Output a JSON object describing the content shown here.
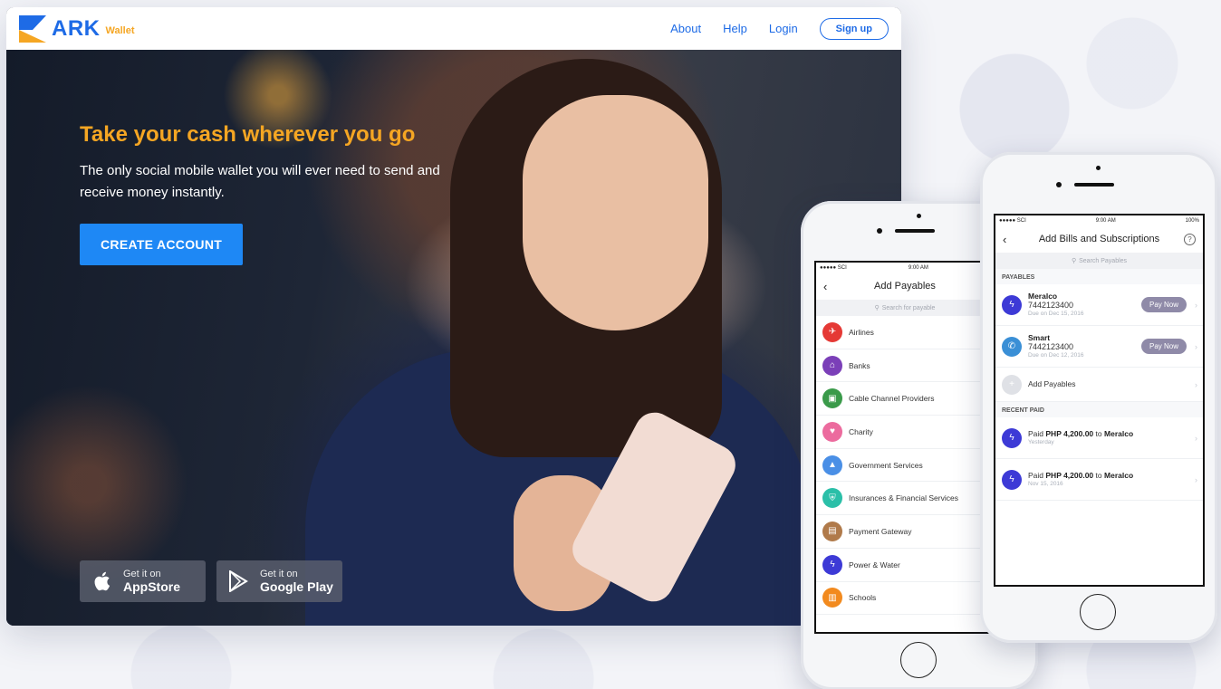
{
  "nav": {
    "brand": "ARK",
    "brand_sub": "Wallet",
    "links": [
      "About",
      "Help",
      "Login"
    ],
    "signup": "Sign up"
  },
  "hero": {
    "title": "Take your cash wherever you go",
    "subtitle": "The only social mobile wallet you will ever need to send and receive money instantly.",
    "cta": "CREATE ACCOUNT",
    "stores": [
      {
        "small": "Get it on",
        "big": "AppStore",
        "icon": "apple-icon"
      },
      {
        "small": "Get it on",
        "big": "Google Play",
        "icon": "play-icon"
      }
    ]
  },
  "phone_left": {
    "status": {
      "carrier": "●●●●● SCI ",
      "time": "9:00 AM"
    },
    "title": "Add Payables",
    "search_placeholder": "Search for payable",
    "categories": [
      {
        "label": "Airlines",
        "color": "#e53935",
        "icon": "plane-icon"
      },
      {
        "label": "Banks",
        "color": "#7b3fb8",
        "icon": "bank-icon"
      },
      {
        "label": "Cable Channel Providers",
        "color": "#3a9a4a",
        "icon": "tv-icon"
      },
      {
        "label": "Charity",
        "color": "#ec6b9e",
        "icon": "heart-icon"
      },
      {
        "label": "Government Services",
        "color": "#4a8fe6",
        "icon": "government-icon"
      },
      {
        "label": "Insurances & Financial Services",
        "color": "#2bbfa8",
        "icon": "shield-icon"
      },
      {
        "label": "Payment Gateway",
        "color": "#b07a4a",
        "icon": "wallet-icon"
      },
      {
        "label": "Power & Water",
        "color": "#3d3ad6",
        "icon": "power-icon"
      },
      {
        "label": "Schools",
        "color": "#f28a1e",
        "icon": "book-icon"
      }
    ]
  },
  "phone_right": {
    "status": {
      "carrier": "●●●●● SCI ",
      "time": "9:00 AM",
      "battery": "100% "
    },
    "title": "Add Bills and Subscriptions",
    "search_placeholder": "Search Payables",
    "payables_head": "PAYABLES",
    "bills": [
      {
        "name": "Meralco",
        "number": "7442123400",
        "due": "Due on Dec 15, 2016",
        "button": "Pay Now",
        "color": "#3d3ad6",
        "icon": "power-icon"
      },
      {
        "name": "Smart",
        "number": "7442123400",
        "due": "Due on Dec 12, 2016",
        "button": "Pay Now",
        "color": "#3a8fd6",
        "icon": "phone-icon"
      }
    ],
    "add_label": "Add Payables",
    "recent_head": "RECENT PAID",
    "recent": [
      {
        "prefix": "Paid",
        "amount": "PHP 4,200.00",
        "to": "to",
        "payee": "Meralco",
        "when": "Yesterday"
      },
      {
        "prefix": "Paid",
        "amount": "PHP 4,200.00",
        "to": "to",
        "payee": "Meralco",
        "when": "Nov 15, 2016"
      }
    ]
  }
}
